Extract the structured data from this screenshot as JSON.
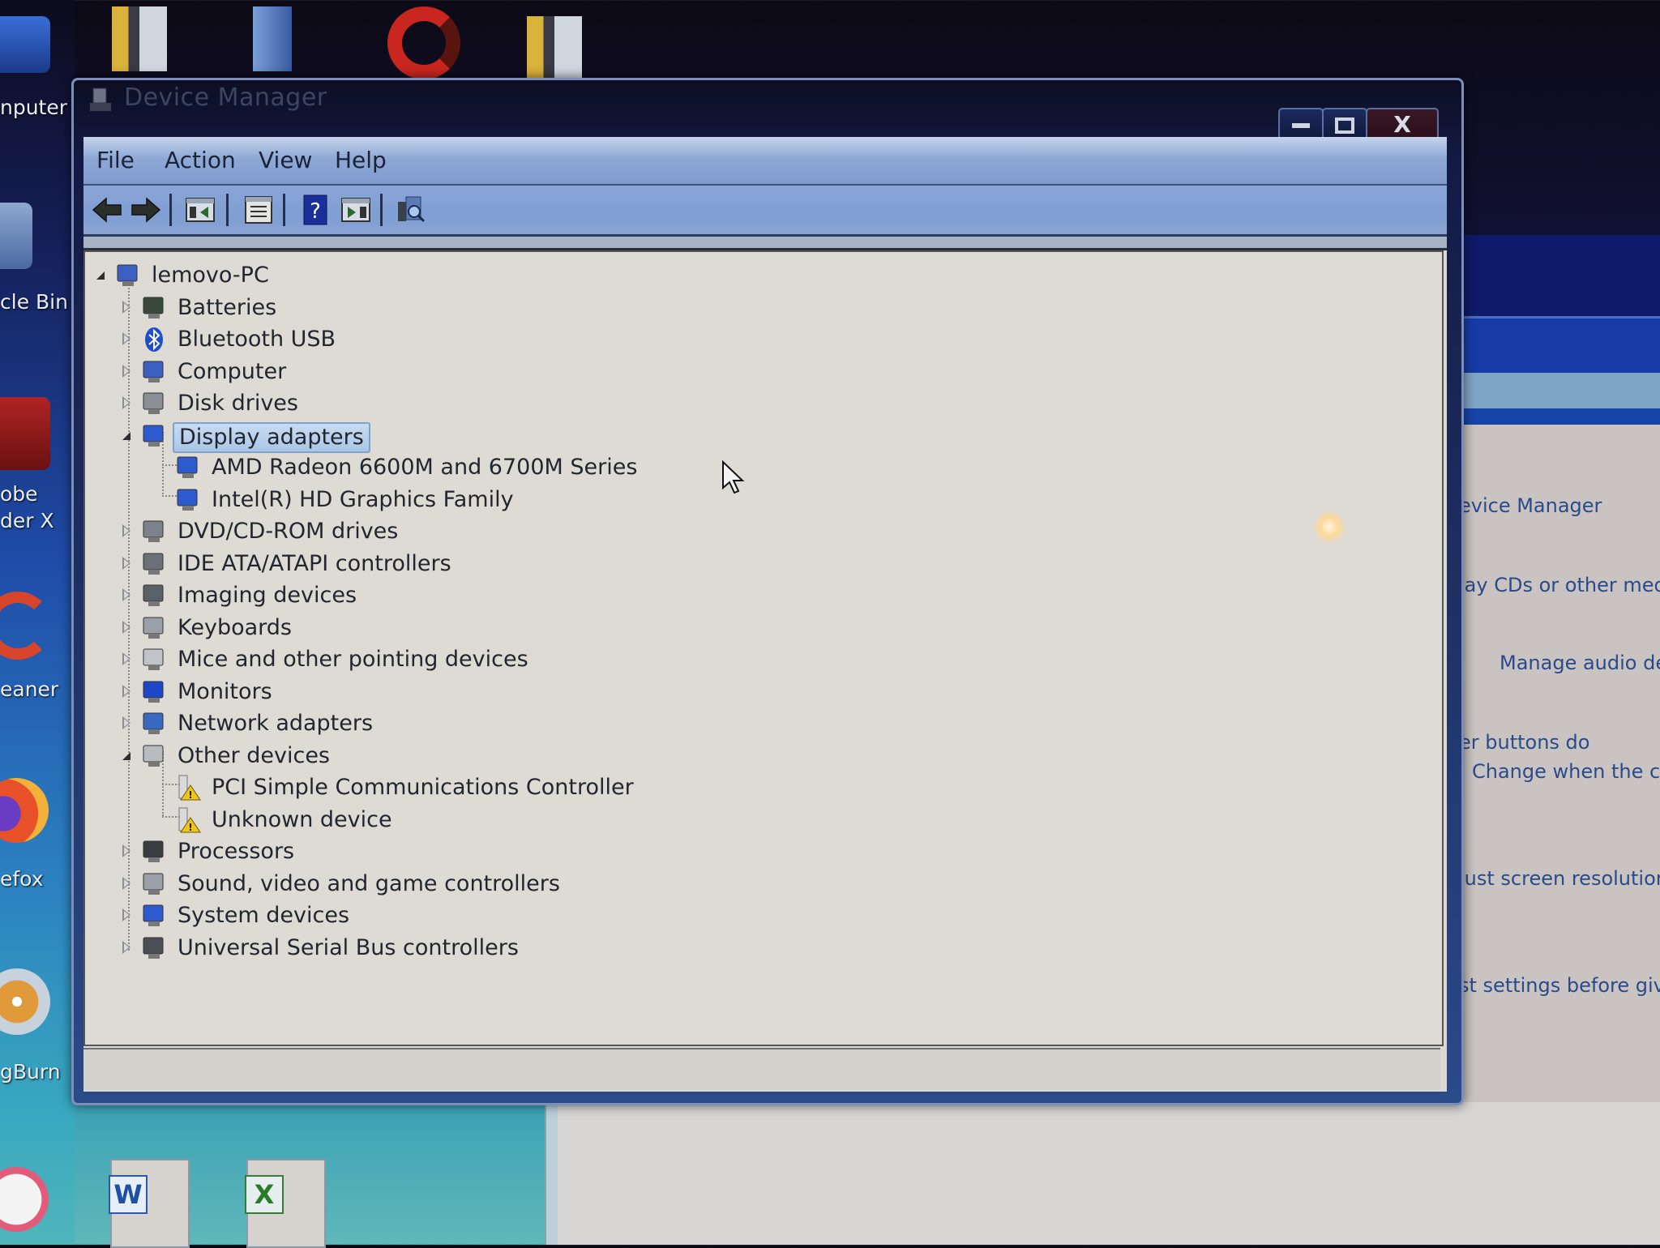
{
  "desktop": {
    "left_icons": [
      {
        "label": "nputer",
        "icon": "computer-icon"
      },
      {
        "label": "cle Bin",
        "icon": "recycle-bin-icon"
      },
      {
        "label": "obe\nder X",
        "line1": "obe",
        "line2": "der X",
        "icon": "adobe-reader-icon"
      },
      {
        "label": "eaner",
        "icon": "ccleaner-icon"
      },
      {
        "label": "efox",
        "icon": "firefox-icon"
      },
      {
        "label": "gBurn",
        "icon": "imgburn-icon"
      },
      {
        "label": "",
        "icon": "itunes-icon"
      }
    ],
    "top_icons": [
      "folder-icon",
      "document-icon",
      "opera-icon",
      "folder-icon"
    ],
    "bottom_icons": [
      "word-document-icon",
      "excel-document-icon"
    ]
  },
  "background_window": {
    "lines": [
      "evice Manager",
      "lay CDs or other media",
      "Manage audio dev",
      "er buttons do",
      "Change when the com",
      "just screen resolution",
      "st settings before givin"
    ]
  },
  "window": {
    "title": "Device Manager",
    "controls": {
      "minimize": "minimize",
      "maximize": "maximize",
      "close": "X"
    },
    "menu": [
      "File",
      "Action",
      "View",
      "Help"
    ],
    "toolbar": [
      {
        "name": "back-button",
        "icon": "arrow-left-icon"
      },
      {
        "name": "forward-button",
        "icon": "arrow-right-icon"
      },
      {
        "name": "show-hide-console-tree-button",
        "icon": "console-tree-icon"
      },
      {
        "name": "properties-button",
        "icon": "properties-icon"
      },
      {
        "name": "help-button",
        "icon": "help-icon"
      },
      {
        "name": "show-action-pane-button",
        "icon": "action-pane-icon"
      },
      {
        "name": "scan-hardware-changes-button",
        "icon": "scan-hardware-icon"
      }
    ],
    "tree": {
      "root": {
        "label": "lemovo-PC",
        "expanded": true,
        "icon": "computer-icon"
      },
      "items": [
        {
          "label": "Batteries",
          "icon": "battery-icon",
          "expanded": false
        },
        {
          "label": "Bluetooth USB",
          "icon": "bluetooth-icon",
          "expanded": false
        },
        {
          "label": "Computer",
          "icon": "computer-icon",
          "expanded": false
        },
        {
          "label": "Disk drives",
          "icon": "disk-drive-icon",
          "expanded": false
        },
        {
          "label": "Display adapters",
          "icon": "display-adapter-icon",
          "expanded": true,
          "selected": true,
          "children": [
            {
              "label": "AMD Radeon 6600M and 6700M Series",
              "icon": "display-adapter-icon"
            },
            {
              "label": "Intel(R) HD Graphics Family",
              "icon": "display-adapter-icon"
            }
          ]
        },
        {
          "label": "DVD/CD-ROM drives",
          "icon": "dvd-drive-icon",
          "expanded": false
        },
        {
          "label": "IDE ATA/ATAPI controllers",
          "icon": "ide-controller-icon",
          "expanded": false
        },
        {
          "label": "Imaging devices",
          "icon": "camera-icon",
          "expanded": false
        },
        {
          "label": "Keyboards",
          "icon": "keyboard-icon",
          "expanded": false
        },
        {
          "label": "Mice and other pointing devices",
          "icon": "mouse-icon",
          "expanded": false
        },
        {
          "label": "Monitors",
          "icon": "monitor-icon",
          "expanded": false
        },
        {
          "label": "Network adapters",
          "icon": "network-adapter-icon",
          "expanded": false
        },
        {
          "label": "Other devices",
          "icon": "unknown-device-icon",
          "expanded": true,
          "children": [
            {
              "label": "PCI Simple Communications Controller",
              "icon": "warning-device-icon"
            },
            {
              "label": "Unknown device",
              "icon": "warning-device-icon"
            }
          ]
        },
        {
          "label": "Processors",
          "icon": "processor-icon",
          "expanded": false
        },
        {
          "label": "Sound, video and game controllers",
          "icon": "speaker-icon",
          "expanded": false
        },
        {
          "label": "System devices",
          "icon": "system-device-icon",
          "expanded": false
        },
        {
          "label": "Universal Serial Bus controllers",
          "icon": "usb-icon",
          "expanded": false
        }
      ]
    },
    "status_bar": ""
  },
  "colors": {
    "selection_bg": "#b8d2ee",
    "menubar_blue": "#8fa9d6",
    "warning_yellow": "#f2c318"
  }
}
